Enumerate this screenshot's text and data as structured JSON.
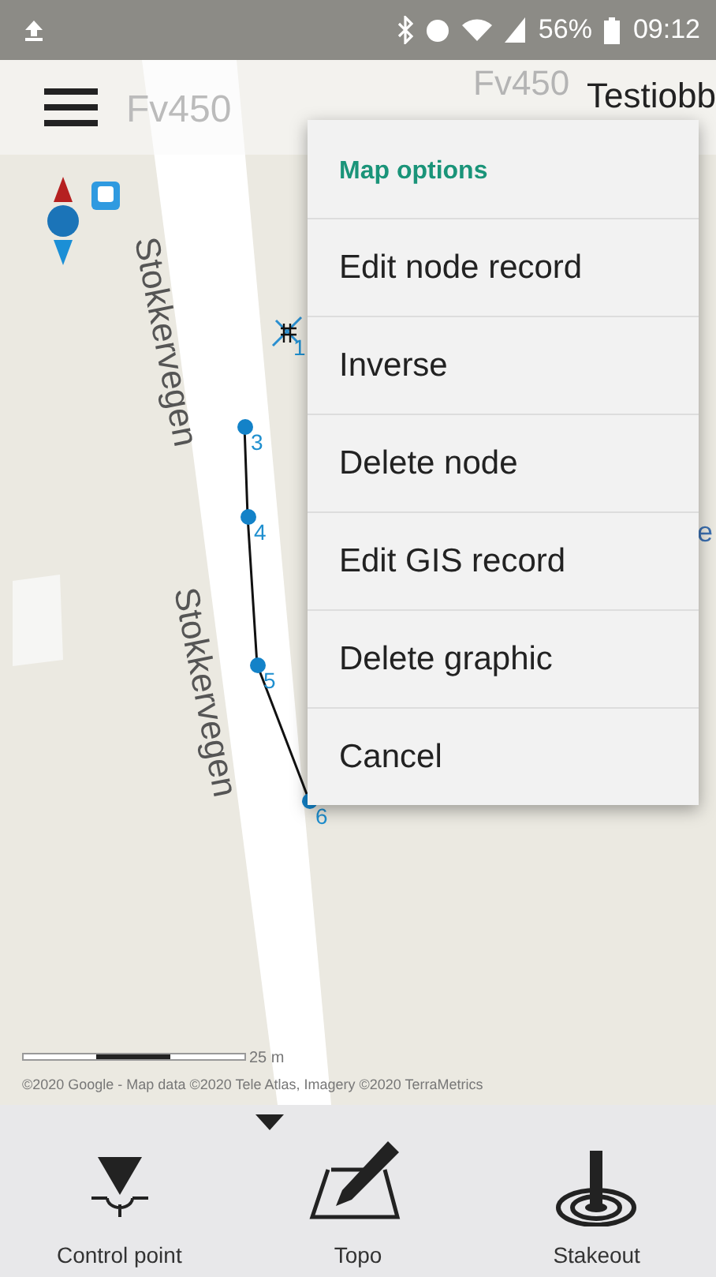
{
  "status_bar": {
    "battery": "56%",
    "time": "09:12"
  },
  "top_bar": {
    "title": "Testiobb"
  },
  "map": {
    "road_labels": [
      {
        "text": "Fv450",
        "kind": "flat"
      },
      {
        "text": "Fv450",
        "kind": "flat"
      },
      {
        "text": "Stokkervegen",
        "kind": "rotated"
      },
      {
        "text": "Stokkervegen",
        "kind": "rotated"
      }
    ],
    "nodes": [
      {
        "label": "1",
        "kind": "control"
      },
      {
        "label": "3",
        "kind": "point"
      },
      {
        "label": "4",
        "kind": "point"
      },
      {
        "label": "5",
        "kind": "point"
      },
      {
        "label": "6",
        "kind": "point"
      }
    ],
    "edge_label": "e",
    "scale": "25 m",
    "attribution": "©2020 Google - Map data ©2020 Tele Atlas, Imagery ©2020 TerraMetrics"
  },
  "menu": {
    "title": "Map options",
    "items": [
      "Edit node record",
      "Inverse",
      "Delete node",
      "Edit GIS record",
      "Delete graphic",
      "Cancel"
    ]
  },
  "toolbar": {
    "items": [
      {
        "label": "Control point",
        "kind": "control"
      },
      {
        "label": "Topo",
        "kind": "topo"
      },
      {
        "label": "Stakeout",
        "kind": "stakeout"
      }
    ]
  }
}
